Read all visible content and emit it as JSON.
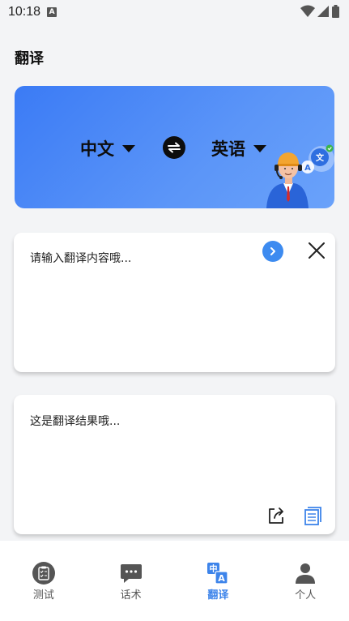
{
  "status": {
    "time": "10:18",
    "badge": "A"
  },
  "page": {
    "title": "翻译"
  },
  "languages": {
    "source": "中文",
    "target": "英语"
  },
  "input": {
    "placeholder": "请输入翻译内容哦..."
  },
  "output": {
    "text": "这是翻译结果哦..."
  },
  "tabs": [
    {
      "label": "测试",
      "icon": "clipboard-check-icon",
      "active": false
    },
    {
      "label": "话术",
      "icon": "chat-bubble-icon",
      "active": false
    },
    {
      "label": "翻译",
      "icon": "translate-icon",
      "active": true
    },
    {
      "label": "个人",
      "icon": "person-icon",
      "active": false
    }
  ],
  "colors": {
    "accent": "#3d84ea",
    "banner_start": "#3b7bf5",
    "banner_end": "#6aa2fa"
  }
}
